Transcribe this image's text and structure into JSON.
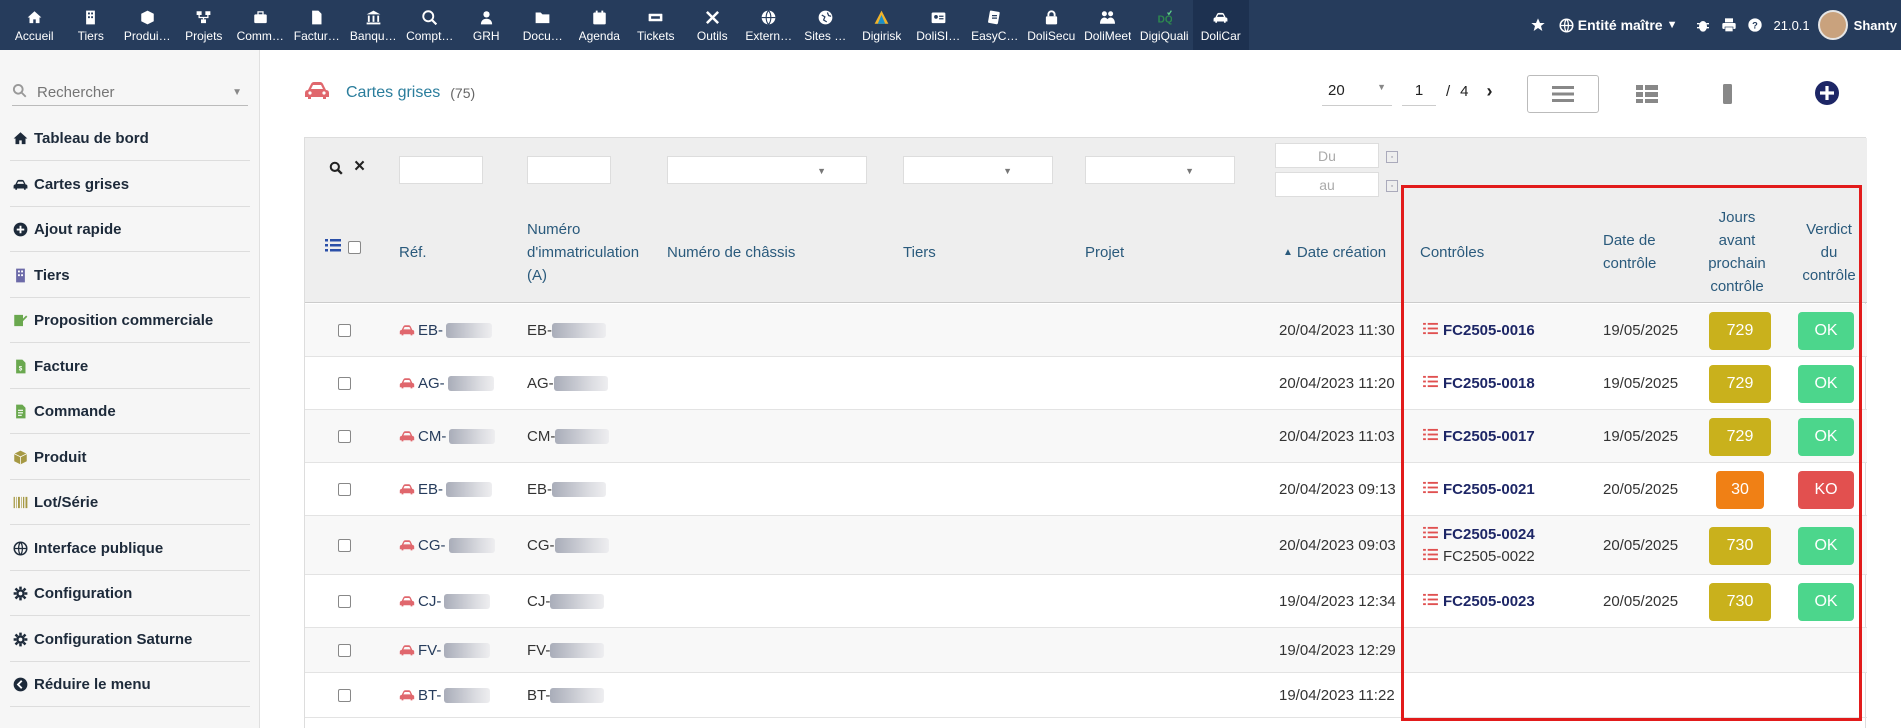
{
  "topbar": {
    "menu": [
      {
        "label": "Accueil",
        "icon": "home-icon"
      },
      {
        "label": "Tiers",
        "icon": "building-icon"
      },
      {
        "label": "Produi…",
        "icon": "cube-icon"
      },
      {
        "label": "Projets",
        "icon": "project-icon"
      },
      {
        "label": "Comm…",
        "icon": "briefcase-icon"
      },
      {
        "label": "Factur…",
        "icon": "file-icon"
      },
      {
        "label": "Banqu…",
        "icon": "bank-icon"
      },
      {
        "label": "Compt…",
        "icon": "search-dollar-icon"
      },
      {
        "label": "GRH",
        "icon": "user-icon"
      },
      {
        "label": "Docu…",
        "icon": "folder-icon"
      },
      {
        "label": "Agenda",
        "icon": "calendar-icon"
      },
      {
        "label": "Tickets",
        "icon": "ticket-icon"
      },
      {
        "label": "Outils",
        "icon": "tools-icon"
      },
      {
        "label": "Extern…",
        "icon": "globe-icon"
      },
      {
        "label": "Sites …",
        "icon": "globe2-icon"
      },
      {
        "label": "Digirisk",
        "icon": "digirisk-icon"
      },
      {
        "label": "DoliSI…",
        "icon": "id-card-icon"
      },
      {
        "label": "EasyC…",
        "icon": "easycrm-icon"
      },
      {
        "label": "DoliSecu",
        "icon": "lock-icon"
      },
      {
        "label": "DoliMeet",
        "icon": "meeting-icon"
      },
      {
        "label": "DigiQuali",
        "icon": "digiquali-icon"
      },
      {
        "label": "DoliCar",
        "icon": "car-icon"
      }
    ],
    "entity": "Entité maître",
    "version": "21.0.1",
    "username": "Shanty"
  },
  "leftmenu": {
    "search_placeholder": "Rechercher",
    "items": [
      {
        "label": "Tableau de bord",
        "icon": "home-icon",
        "color": "#1d2a3a"
      },
      {
        "label": "Cartes grises",
        "icon": "car-icon",
        "color": "#1d2a3a"
      },
      {
        "label": "Ajout rapide",
        "icon": "plus-circle-icon",
        "color": "#1d2a3a"
      },
      {
        "label": "Tiers",
        "icon": "building-icon",
        "color": "#6c6aa8"
      },
      {
        "label": "Proposition commerciale",
        "icon": "proposal-icon",
        "color": "#6aa84f"
      },
      {
        "label": "Facture",
        "icon": "invoice-icon",
        "color": "#6aa84f"
      },
      {
        "label": "Commande",
        "icon": "order-icon",
        "color": "#6aa84f"
      },
      {
        "label": "Produit",
        "icon": "cube-icon",
        "color": "#a69944"
      },
      {
        "label": "Lot/Série",
        "icon": "barcode-icon",
        "color": "#a69944"
      },
      {
        "label": "Interface publique",
        "icon": "globe-icon",
        "color": "#1d2a3a"
      },
      {
        "label": "Configuration",
        "icon": "gear-icon",
        "color": "#1d2a3a"
      },
      {
        "label": "Configuration Saturne",
        "icon": "gear-icon",
        "color": "#1d2a3a"
      },
      {
        "label": "Réduire le menu",
        "icon": "chevron-left-circle-icon",
        "color": "#1d2a3a"
      }
    ]
  },
  "main": {
    "title": "Cartes grises",
    "count": "(75)",
    "page_size": "20",
    "page": "1",
    "page_sep": "/",
    "page_total": "4"
  },
  "filters": {
    "date_from": "Du",
    "date_to": "au"
  },
  "columns": {
    "ref": "Réf.",
    "immat_1": "Numéro",
    "immat_2": "d'immatriculation",
    "immat_3": "(A)",
    "chassis": "Numéro de châssis",
    "tiers": "Tiers",
    "projet": "Projet",
    "date_creation": "Date création",
    "controles": "Contrôles",
    "date_controle_1": "Date de",
    "date_controle_2": "contrôle",
    "jours_1": "Jours",
    "jours_2": "avant",
    "jours_3": "prochain",
    "jours_4": "contrôle",
    "verdict_1": "Verdict",
    "verdict_2": "du",
    "verdict_3": "contrôle"
  },
  "rows": [
    {
      "ref": "EB-",
      "immat": "EB-",
      "date": "20/04/2023 11:30",
      "controls": [
        "FC2505-0016"
      ],
      "control_date": "19/05/2025",
      "days": "729",
      "days_color": "#c9b11c",
      "verdict": "OK",
      "verdict_color": "#4cd68c"
    },
    {
      "ref": "AG-",
      "immat": "AG-",
      "date": "20/04/2023 11:20",
      "controls": [
        "FC2505-0018"
      ],
      "control_date": "19/05/2025",
      "days": "729",
      "days_color": "#c9b11c",
      "verdict": "OK",
      "verdict_color": "#4cd68c"
    },
    {
      "ref": "CM-",
      "immat": "CM-",
      "date": "20/04/2023 11:03",
      "controls": [
        "FC2505-0017"
      ],
      "control_date": "19/05/2025",
      "days": "729",
      "days_color": "#c9b11c",
      "verdict": "OK",
      "verdict_color": "#4cd68c"
    },
    {
      "ref": "EB-",
      "immat": "EB-",
      "date": "20/04/2023 09:13",
      "controls": [
        "FC2505-0021"
      ],
      "control_date": "20/05/2025",
      "days": "30",
      "days_color": "#f08015",
      "verdict": "KO",
      "verdict_color": "#e2504f"
    },
    {
      "ref": "CG-",
      "immat": "CG-",
      "date": "20/04/2023 09:03",
      "controls": [
        "FC2505-0024",
        "FC2505-0022"
      ],
      "control_date": "20/05/2025",
      "days": "730",
      "days_color": "#c9b11c",
      "verdict": "OK",
      "verdict_color": "#4cd68c"
    },
    {
      "ref": "CJ-",
      "immat": "CJ-",
      "date": "19/04/2023 12:34",
      "controls": [
        "FC2505-0023"
      ],
      "control_date": "20/05/2025",
      "days": "730",
      "days_color": "#c9b11c",
      "verdict": "OK",
      "verdict_color": "#4cd68c"
    },
    {
      "ref": "FV-",
      "immat": "FV-",
      "date": "19/04/2023 12:29",
      "controls": [],
      "control_date": "",
      "days": "",
      "verdict": ""
    },
    {
      "ref": "BT-",
      "immat": "BT-",
      "date": "19/04/2023 11:22",
      "controls": [],
      "control_date": "",
      "days": "",
      "verdict": ""
    }
  ]
}
